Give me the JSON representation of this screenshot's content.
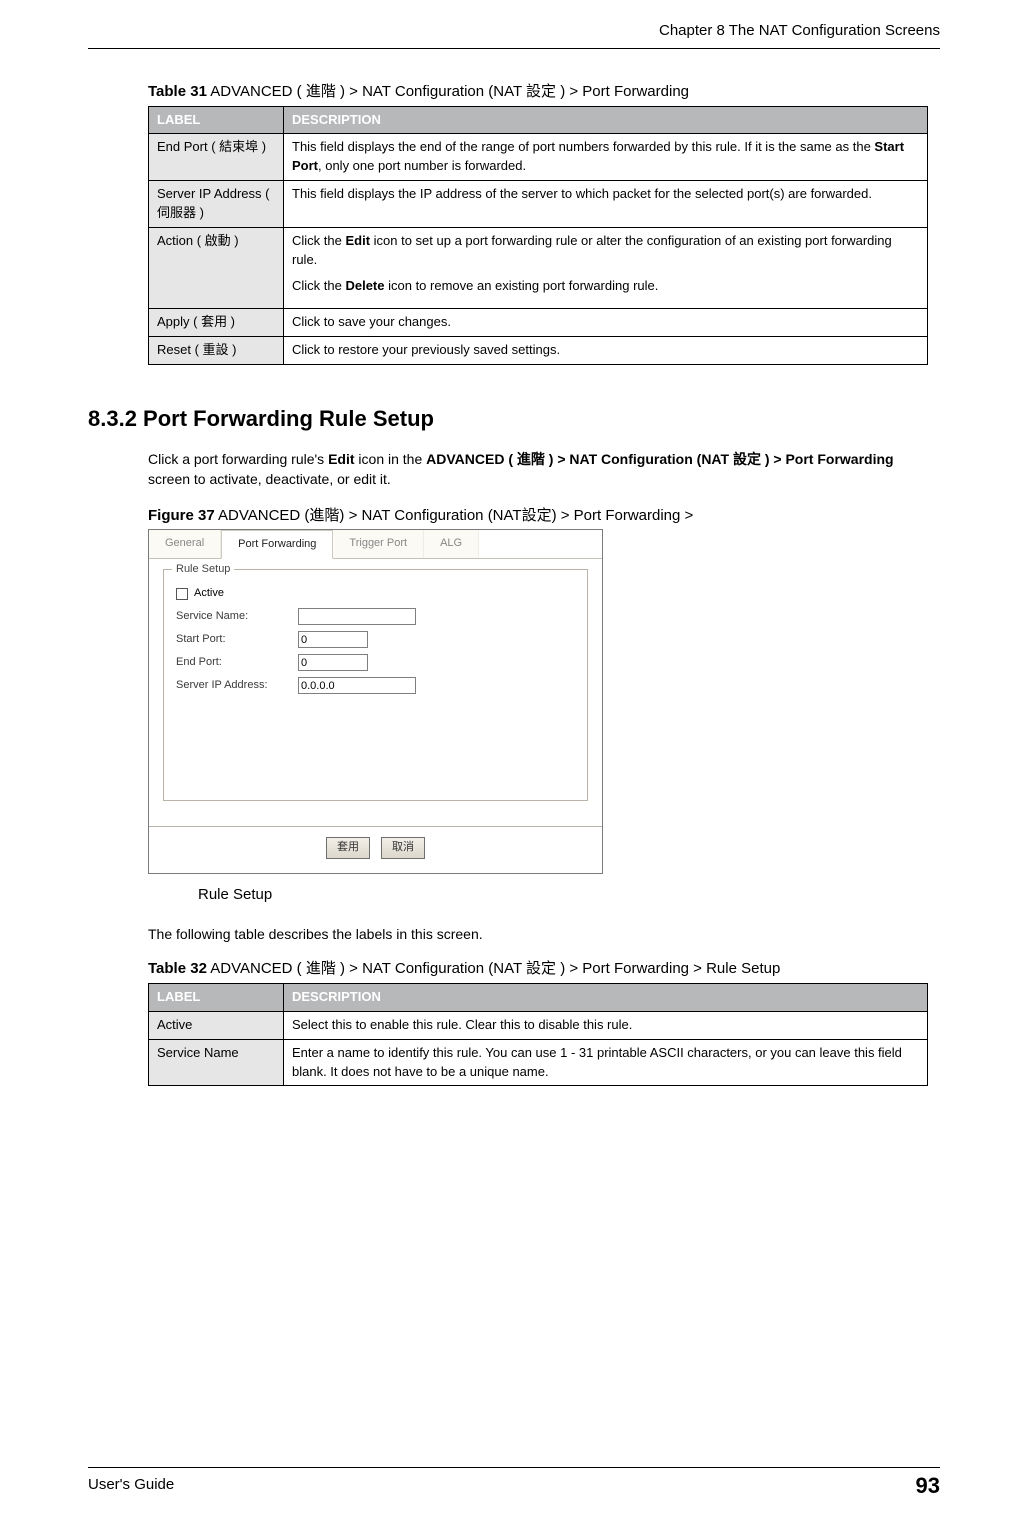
{
  "runningHead": "Chapter 8 The NAT Configuration Screens",
  "table31": {
    "captionNum": "Table 31",
    "captionText": "   ADVANCED ( 進階 ) > NAT Configuration (NAT 設定 )  > Port Forwarding",
    "header": {
      "label": "LABEL",
      "desc": "DESCRIPTION"
    },
    "rows": [
      {
        "label": "End Port ( 結束埠 )",
        "descHtml": "This field displays the end of the range of port numbers forwarded by this rule. If it is the same as the <b>Start Port</b>, only one port number is forwarded."
      },
      {
        "label": "Server IP Address ( 伺服器 )",
        "descHtml": "This field displays the IP address of the server to which packet for the selected port(s) are forwarded."
      },
      {
        "label": "Action ( 啟動 )",
        "descHtml": "<p>Click the <b>Edit</b> icon to set up a port forwarding rule or alter the configuration of an existing port forwarding rule.</p><p>Click the <b>Delete</b> icon to remove an existing port forwarding rule.</p>"
      },
      {
        "label": "Apply ( 套用 )",
        "descHtml": "Click to save your changes."
      },
      {
        "label": "Reset ( 重設 )",
        "descHtml": "Click to restore your previously saved settings."
      }
    ]
  },
  "sectionHeading": "8.3.2  Port Forwarding Rule Setup",
  "paraIntroHtml": "Click a port forwarding rule's <b>Edit</b> icon in the <b>ADVANCED ( 進階 ) > NAT Configuration (NAT 設定 ) > Port Forwarding</b> screen to activate, deactivate, or edit it.",
  "figure37": {
    "num": "Figure 37",
    "text": "   ADVANCED (進階) > NAT Configuration (NAT設定)  > Port Forwarding >",
    "subCaption": "Rule Setup"
  },
  "ui": {
    "tabs": {
      "general": "General",
      "portForwarding": "Port Forwarding",
      "triggerPort": "Trigger Port",
      "alg": "ALG"
    },
    "fieldset": "Rule Setup",
    "labels": {
      "active": "Active",
      "serviceName": "Service Name:",
      "startPort": "Start Port:",
      "endPort": "End Port:",
      "serverIp": "Server IP Address:"
    },
    "values": {
      "serviceName": "",
      "startPort": "0",
      "endPort": "0",
      "serverIp": "0.0.0.0"
    },
    "buttons": {
      "apply": "套用",
      "cancel": "取消"
    }
  },
  "paraTableIntro": "The following table describes the labels in this screen.",
  "table32": {
    "captionNum": "Table 32",
    "captionText": "   ADVANCED ( 進階 ) > NAT Configuration (NAT 設定 )  > Port Forwarding > Rule Setup",
    "header": {
      "label": "LABEL",
      "desc": "DESCRIPTION"
    },
    "rows": [
      {
        "label": "Active",
        "descHtml": "Select this to enable this rule. Clear this to disable this rule."
      },
      {
        "label": "Service Name",
        "descHtml": "Enter a name to identify this rule. You can use 1 - 31 printable ASCII characters, or you can leave this field blank. It does not have to be a unique name."
      }
    ]
  },
  "footer": {
    "left": "User's Guide",
    "page": "93"
  }
}
